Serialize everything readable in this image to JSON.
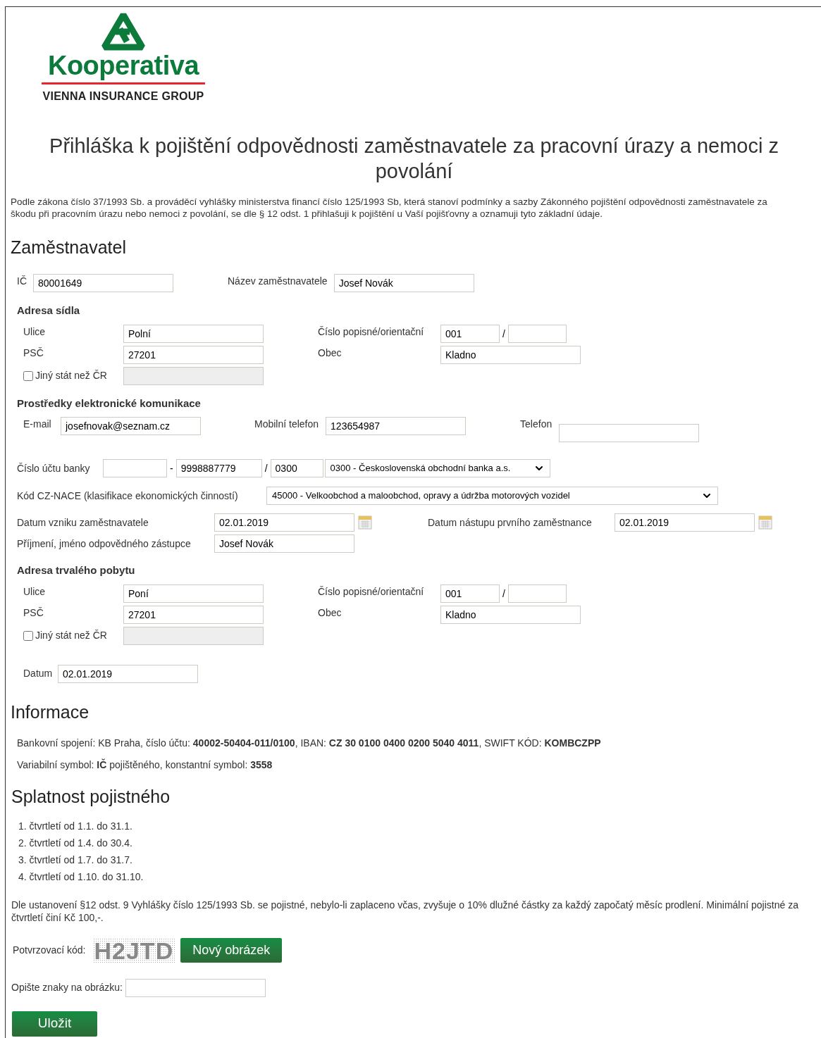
{
  "logo": {
    "name": "Kooperativa",
    "tagline": "VIENNA INSURANCE GROUP"
  },
  "title": "Přihláška k pojištění odpovědnosti zaměstnavatele za pracovní úrazy a nemoci z povolání",
  "intro": "Podle zákona číslo 37/1993 Sb. a prováděcí vyhlášky ministerstva financí číslo 125/1993 Sb, která stanoví podmínky a sazby Zákonného pojištění odpovědnosti zaměstnavatele za škodu při pracovním úrazu nebo nemoci z povolání, se dle § 12 odst. 1 přihlašuji k pojištění u Vaší pojišťovny a oznamuji tyto základní údaje.",
  "employer": {
    "heading": "Zaměstnavatel",
    "ic": {
      "label": "IČ",
      "value": "80001649"
    },
    "name": {
      "label": "Název zaměstnavatele",
      "value": "Josef Novák"
    }
  },
  "seat_address": {
    "heading": "Adresa sídla",
    "street": {
      "label": "Ulice",
      "value": "Polní"
    },
    "number": {
      "label": "Číslo popisné/orientační",
      "value": "001",
      "separator": "/"
    },
    "psc": {
      "label": "PSČ",
      "value": "27201"
    },
    "city": {
      "label": "Obec",
      "value": "Kladno"
    },
    "foreign": {
      "label": "Jiný stát než ČR",
      "checked": false
    }
  },
  "contact": {
    "heading": "Prostředky elektronické komunikace",
    "email": {
      "label": "E-mail",
      "value": "josefnovak@seznam.cz"
    },
    "mobile": {
      "label": "Mobilní telefon",
      "value": "123654987"
    },
    "phone": {
      "label": "Telefon"
    }
  },
  "bank_account": {
    "label": "Číslo účtu banky",
    "dash": "-",
    "number": "9998887779",
    "slash": "/",
    "code": "0300",
    "bank": "0300 - Československá obchodní banka a.s."
  },
  "nace": {
    "label": "Kód CZ-NACE (klasifikace ekonomických činností)",
    "value": "45000 - Velkoobchod a maloobchod, opravy a údržba motorových vozidel"
  },
  "founded": {
    "label": "Datum vzniku zaměstnavatele",
    "value": "02.01.2019"
  },
  "first_employee": {
    "label": "Datum nástupu prvního zaměstnance",
    "value": "02.01.2019"
  },
  "representative": {
    "label": "Příjmení, jméno odpovědného zástupce",
    "value": "Josef Novák"
  },
  "permanent_address": {
    "heading": "Adresa trvalého pobytu",
    "street": {
      "label": "Ulice",
      "value": "Poní"
    },
    "number": {
      "label": "Číslo popisné/orientační",
      "value": "001",
      "separator": "/"
    },
    "psc": {
      "label": "PSČ",
      "value": "27201"
    },
    "city": {
      "label": "Obec",
      "value": "Kladno"
    },
    "foreign": {
      "label": "Jiný stát než ČR",
      "checked": false
    }
  },
  "date": {
    "label": "Datum",
    "value": "02.01.2019"
  },
  "info": {
    "heading": "Informace",
    "lines": [
      "Bankovní spojení: KB Praha, číslo účtu: **40002-50404-011/0100**, IBAN: **CZ 30 0100 0400 0200 5040 4011**, SWIFT KÓD: **KOMBCZPP**",
      "Variabilní symbol: **IČ** pojištěného, konstantní symbol: **3558**"
    ]
  },
  "due": {
    "heading": "Splatnost pojistného",
    "items": [
      "1. čtvrtletí od 1.1. do 31.1.",
      "2. čtvrtletí od 1.4. do 30.4.",
      "3. čtvrtletí od 1.7. do 31.7.",
      "4. čtvrtletí od 1.10. do 31.10."
    ],
    "note": "Dle ustanovení §12 odst. 9 Vyhlášky číslo 125/1993 Sb. se pojistné, nebylo-li zaplaceno včas, zvyšuje o 10% dlužné částky za každý započatý měsíc prodlení. Minimální pojistné za čtvrtletí činí Kč 100,-."
  },
  "captcha": {
    "label": "Potvrzovací kód:",
    "code": "H2JTD",
    "refresh_button": "Nový obrázek",
    "input_label": "Opište znaky na obrázku:"
  },
  "submit_button": "Uložit"
}
